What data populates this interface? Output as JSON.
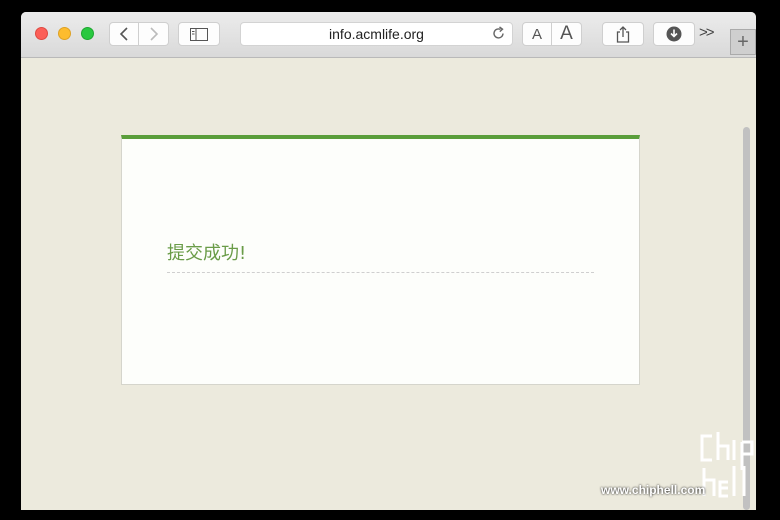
{
  "browser": {
    "url": "info.acmlife.org",
    "font_small_label": "A",
    "font_large_label": "A",
    "more_label": ">>",
    "newtab_label": "+"
  },
  "page": {
    "message": "提交成功!"
  },
  "watermark": {
    "text": "www.chiphell.com"
  },
  "colors": {
    "accent": "#5a9e3a",
    "message": "#6a9c48",
    "page_bg": "#eceadd"
  }
}
